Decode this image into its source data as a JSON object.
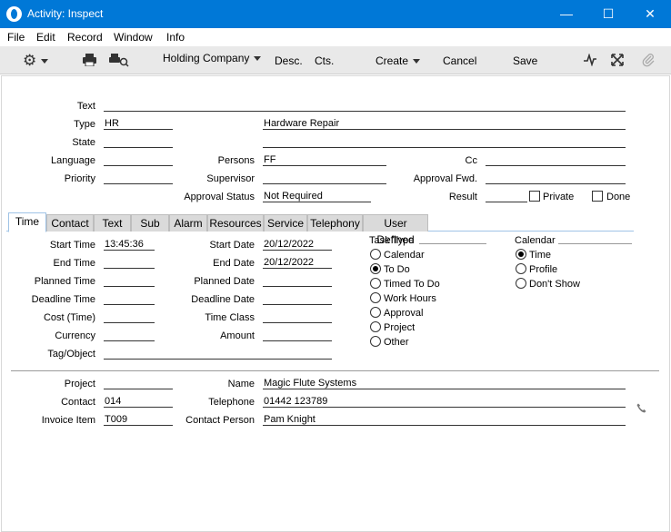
{
  "window": {
    "title": "Activity: Inspect",
    "minimize": "—",
    "maximize": "☐",
    "close": "✕"
  },
  "menu": [
    "File",
    "Edit",
    "Record",
    "Window",
    "Info"
  ],
  "toolbar": {
    "company": "Holding Company",
    "desc": "Desc.",
    "cts": "Cts.",
    "create": "Create",
    "cancel": "Cancel",
    "save": "Save"
  },
  "header": {
    "text_label": "Text",
    "text_value": "",
    "type_label": "Type",
    "type_value": "HR",
    "type_desc": "Hardware Repair",
    "state_label": "State",
    "state_value": "",
    "state_desc": "",
    "language_label": "Language",
    "language_value": "",
    "persons_label": "Persons",
    "persons_value": "FF",
    "cc_label": "Cc",
    "cc_value": "",
    "priority_label": "Priority",
    "priority_value": "",
    "supervisor_label": "Supervisor",
    "supervisor_value": "",
    "approval_fwd_label": "Approval Fwd.",
    "approval_fwd_value": "",
    "approval_status_label": "Approval Status",
    "approval_status_value": "Not Required",
    "result_label": "Result",
    "result_value": "",
    "private_label": "Private",
    "done_label": "Done"
  },
  "tabs": [
    "Time",
    "Contact",
    "Text",
    "Sub",
    "Alarm",
    "Resources",
    "Service",
    "Telephony",
    "User Defined"
  ],
  "time_tab": {
    "start_time_label": "Start Time",
    "start_time": "13:45:36",
    "end_time_label": "End Time",
    "end_time": "",
    "planned_time_label": "Planned Time",
    "planned_time": "",
    "deadline_time_label": "Deadline Time",
    "deadline_time": "",
    "cost_time_label": "Cost (Time)",
    "cost_time": "",
    "currency_label": "Currency",
    "currency": "",
    "tag_label": "Tag/Object",
    "tag": "",
    "start_date_label": "Start Date",
    "start_date": "20/12/2022",
    "end_date_label": "End Date",
    "end_date": "20/12/2022",
    "planned_date_label": "Planned Date",
    "planned_date": "",
    "deadline_date_label": "Deadline Date",
    "deadline_date": "",
    "time_class_label": "Time Class",
    "time_class": "",
    "amount_label": "Amount",
    "amount": "",
    "task_type_label": "Task Type",
    "task_types": [
      "Calendar",
      "To Do",
      "Timed To Do",
      "Work Hours",
      "Approval",
      "Project",
      "Other"
    ],
    "task_type_selected": "To Do",
    "calendar_label": "Calendar",
    "calendar_options": [
      "Time",
      "Profile",
      "Don't Show"
    ],
    "calendar_selected": "Time"
  },
  "footer": {
    "project_label": "Project",
    "project": "",
    "contact_label": "Contact",
    "contact": "014",
    "invoice_item_label": "Invoice Item",
    "invoice_item": "T009",
    "name_label": "Name",
    "name": "Magic Flute Systems",
    "telephone_label": "Telephone",
    "telephone": "01442 123789",
    "contact_person_label": "Contact Person",
    "contact_person": "Pam Knight"
  }
}
